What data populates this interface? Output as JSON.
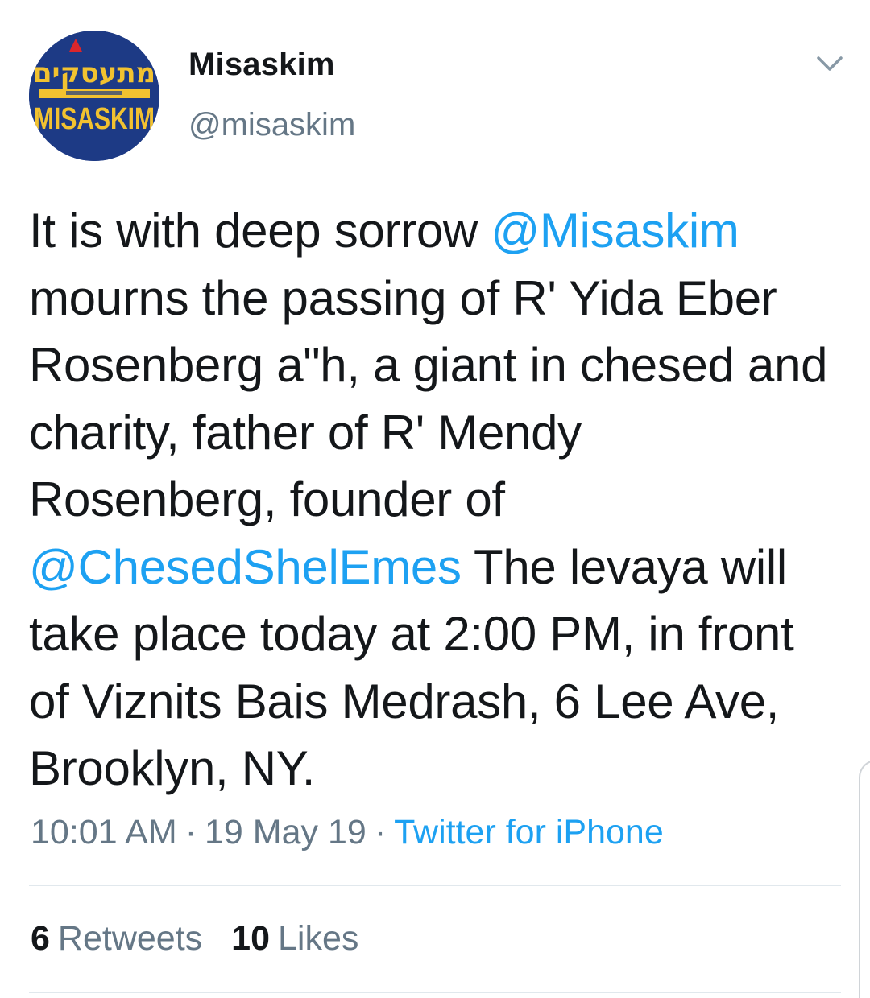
{
  "user": {
    "display_name": "Misaskim",
    "handle": "@misaskim",
    "avatar": {
      "hebrew_text": "מתעסקים",
      "latin_text": "MISASKIM",
      "bg_color": "#1d3a85",
      "top_color": "#d9262c",
      "band_color": "#f2c230"
    }
  },
  "menu_icon": "chevron-down-icon",
  "tweet": {
    "segments": [
      {
        "type": "text",
        "value": "It is with deep sorrow "
      },
      {
        "type": "mention",
        "value": "@Misaskim"
      },
      {
        "type": "text",
        "value": " mourns the passing of R' Yida Eber Rosenberg a\"h, a giant in chesed and charity, father of R' Mendy Rosenberg, founder of "
      },
      {
        "type": "mention",
        "value": "@ChesedShelEmes"
      },
      {
        "type": "text",
        "value": " The levaya will take place today at 2:00 PM, in front of Viznits Bais Medrash, 6 Lee Ave, Brooklyn, NY."
      }
    ]
  },
  "meta": {
    "time": "10:01 AM",
    "separator": "·",
    "date": "19 May 19",
    "source": "Twitter for iPhone"
  },
  "stats": {
    "retweets_count": "6",
    "retweets_label": "Retweets",
    "likes_count": "10",
    "likes_label": "Likes"
  },
  "colors": {
    "link": "#1da1f2",
    "secondary_text": "#657786",
    "primary_text": "#14171a",
    "divider": "#e1e8ed"
  }
}
